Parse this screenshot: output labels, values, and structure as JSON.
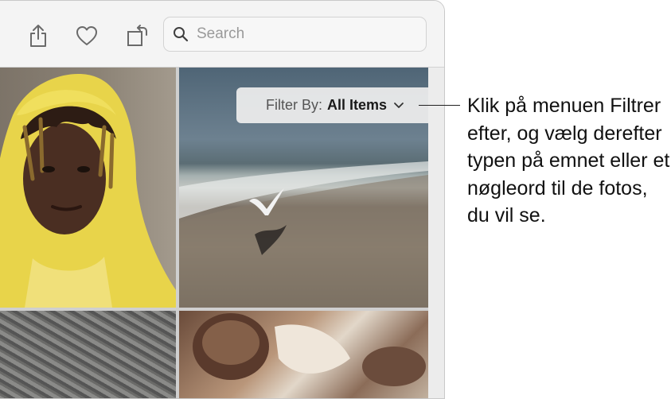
{
  "toolbar": {
    "icons": [
      "share-icon",
      "heart-icon",
      "rotate-icon",
      "search-icon"
    ],
    "search": {
      "placeholder": "Search",
      "value": ""
    }
  },
  "filter": {
    "label": "Filter By:",
    "value": "All Items"
  },
  "photos": [
    "portrait-yellow-raincoat",
    "beach-seagull",
    "knit-texture",
    "seashells"
  ],
  "callout": {
    "text": "Klik på menuen Filtrer efter, og vælg derefter typen på emnet eller et nøgleord til de fotos, du vil se."
  }
}
